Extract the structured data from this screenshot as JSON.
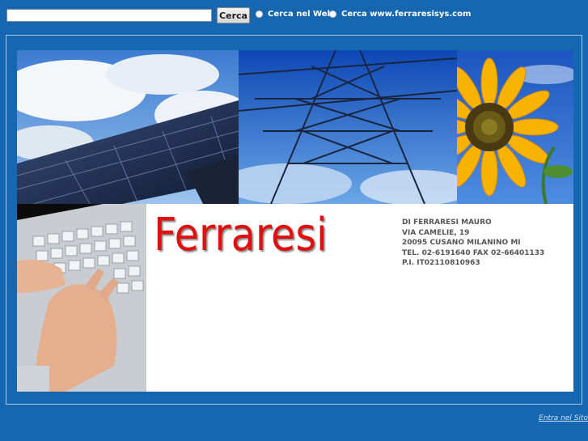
{
  "search": {
    "value": "",
    "button_label": "Cerca",
    "options": [
      {
        "label": "Cerca nel Web"
      },
      {
        "label": "Cerca www.ferraresisys.com"
      }
    ]
  },
  "brand": {
    "name": "Ferraresi"
  },
  "address": {
    "lines": [
      "DI FERRARESI MAURO",
      "VIA CAMELIE, 19",
      "20095 CUSANO MILANINO MI",
      "TEL. 02-6191640 FAX 02-66401133",
      "P.I. IT02110810963"
    ]
  },
  "footer": {
    "enter_link": "Entra nel Sito"
  },
  "photos": [
    {
      "subject": "solar-panels"
    },
    {
      "subject": "power-pylon"
    },
    {
      "subject": "sunflower"
    },
    {
      "subject": "laptop-typing"
    }
  ],
  "colors": {
    "page_bg": "#1666b0",
    "brand": "#e01010"
  }
}
